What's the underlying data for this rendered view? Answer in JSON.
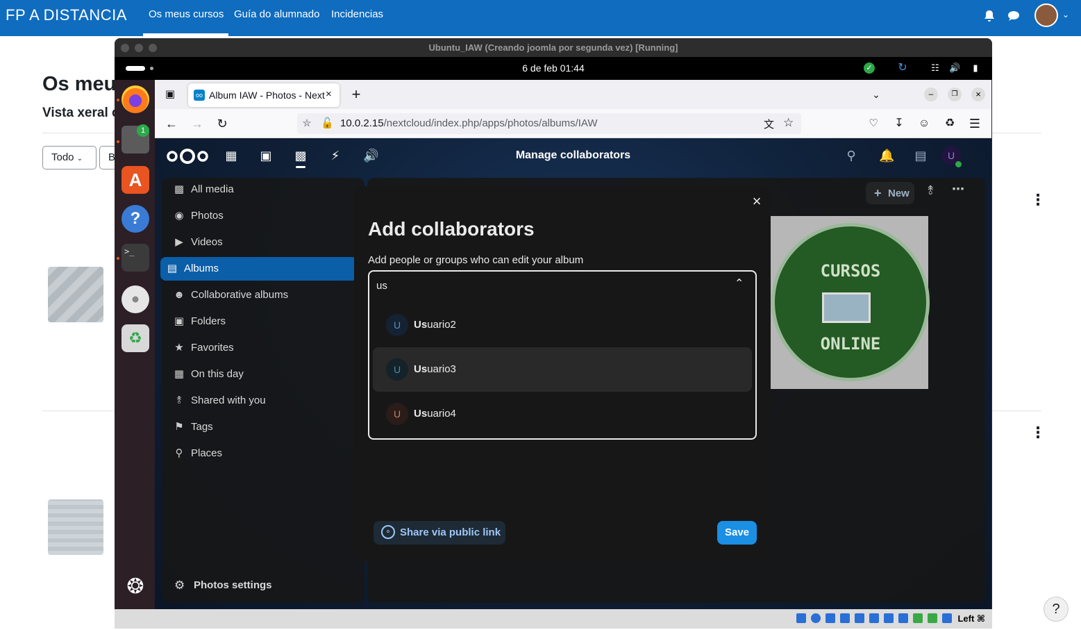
{
  "moodle": {
    "brand": "FP A DISTANCIA",
    "nav": [
      "Os meus cursos",
      "Guía do alumnado",
      "Incidencias"
    ],
    "page_title": "Os meu",
    "subtitle": "Vista xeral c",
    "filter_label": "Todo",
    "filter2_label": "B",
    "help": "?"
  },
  "vbox": {
    "title": "Ubuntu_IAW (Creando joomla por segunda vez) [Running]",
    "status_text": "Left ⌘"
  },
  "gnome": {
    "clock": "6 de feb  01:44",
    "files_badge": "1"
  },
  "firefox": {
    "tab_title": "Album IAW - Photos - Next",
    "url_host": "10.0.2.15",
    "url_path": "/nextcloud/index.php/apps/photos/albums/IAW"
  },
  "nextcloud": {
    "header_title": "Manage collaborators",
    "user_initial": "U",
    "new_button": "New",
    "nav": [
      {
        "label": "All media",
        "icon": "image-icon"
      },
      {
        "label": "Photos",
        "icon": "camera-icon"
      },
      {
        "label": "Videos",
        "icon": "video-icon"
      },
      {
        "label": "Albums",
        "icon": "album-icon"
      },
      {
        "label": "Collaborative albums",
        "icon": "people-icon"
      },
      {
        "label": "Folders",
        "icon": "folder-icon"
      },
      {
        "label": "Favorites",
        "icon": "star-icon"
      },
      {
        "label": "On this day",
        "icon": "calendar-icon"
      },
      {
        "label": "Shared with you",
        "icon": "share-icon"
      },
      {
        "label": "Tags",
        "icon": "tag-icon"
      },
      {
        "label": "Places",
        "icon": "pin-icon"
      }
    ],
    "settings_label": "Photos settings",
    "photo_text_top": "CURSOS",
    "photo_text_bottom": "ONLINE"
  },
  "modal": {
    "title": "Add collaborators",
    "description": "Add people or groups who can edit your album",
    "search_value": "us",
    "options": [
      {
        "initial": "U",
        "match": "Us",
        "rest": "uario2"
      },
      {
        "initial": "U",
        "match": "Us",
        "rest": "uario3"
      },
      {
        "initial": "U",
        "match": "Us",
        "rest": "uario4"
      }
    ],
    "public_link_label": "Share via public link",
    "save_label": "Save"
  },
  "colors": {
    "moodle_blue": "#0f6cbf",
    "nc_primary": "#0b5ea8",
    "save_blue": "#1a8fe3"
  }
}
